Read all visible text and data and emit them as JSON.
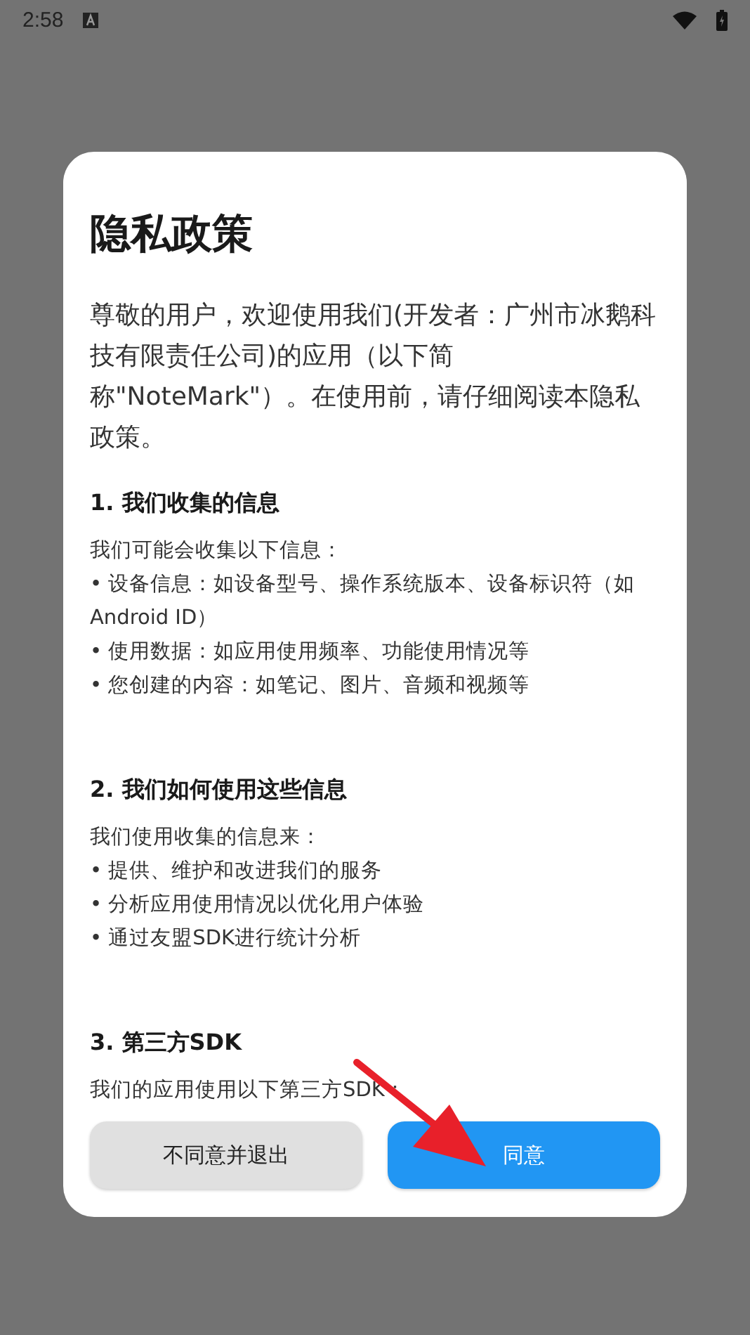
{
  "status_bar": {
    "time": "2:58"
  },
  "dialog": {
    "title": "隐私政策",
    "intro": "尊敬的用户，欢迎使用我们(开发者：广州市冰鹅科技有限责任公司)的应用（以下简称\"NoteMark\"）。在使用前，请仔细阅读本隐私政策。",
    "sections": [
      {
        "heading": "1. 我们收集的信息",
        "lines": [
          "我们可能会收集以下信息：",
          "• 设备信息：如设备型号、操作系统版本、设备标识符（如Android ID）",
          "• 使用数据：如应用使用频率、功能使用情况等",
          "• 您创建的内容：如笔记、图片、音频和视频等"
        ]
      },
      {
        "heading": "2. 我们如何使用这些信息",
        "lines": [
          "我们使用收集的信息来：",
          "• 提供、维护和改进我们的服务",
          "• 分析应用使用情况以优化用户体验",
          "• 通过友盟SDK进行统计分析"
        ]
      },
      {
        "heading": "3. 第三方SDK",
        "lines": [
          "我们的应用使用以下第三方SDK："
        ]
      }
    ],
    "buttons": [
      {
        "label": "不同意并退出",
        "kind": "secondary"
      },
      {
        "label": "同意",
        "kind": "primary"
      }
    ]
  }
}
